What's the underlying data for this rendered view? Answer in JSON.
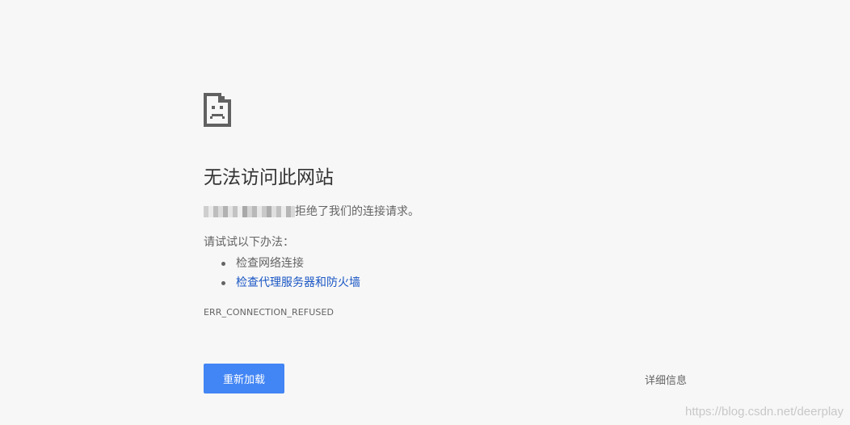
{
  "page": {
    "title": "无法访问此网站",
    "message_suffix": "拒绝了我们的连接请求。",
    "suggestions_heading": "请试试以下办法：",
    "suggestions": [
      {
        "label": "检查网络连接",
        "is_link": false
      },
      {
        "label": "检查代理服务器和防火墙",
        "is_link": true
      }
    ],
    "error_code": "ERR_CONNECTION_REFUSED"
  },
  "buttons": {
    "reload_label": "重新加载",
    "details_label": "详细信息"
  },
  "watermark": "https://blog.csdn.net/deerplay",
  "icons": {
    "error": "sad-document-icon"
  },
  "colors": {
    "background": "#f7f7f7",
    "title": "#333333",
    "text": "#646464",
    "link": "#1a56c4",
    "button": "#4285f4"
  }
}
